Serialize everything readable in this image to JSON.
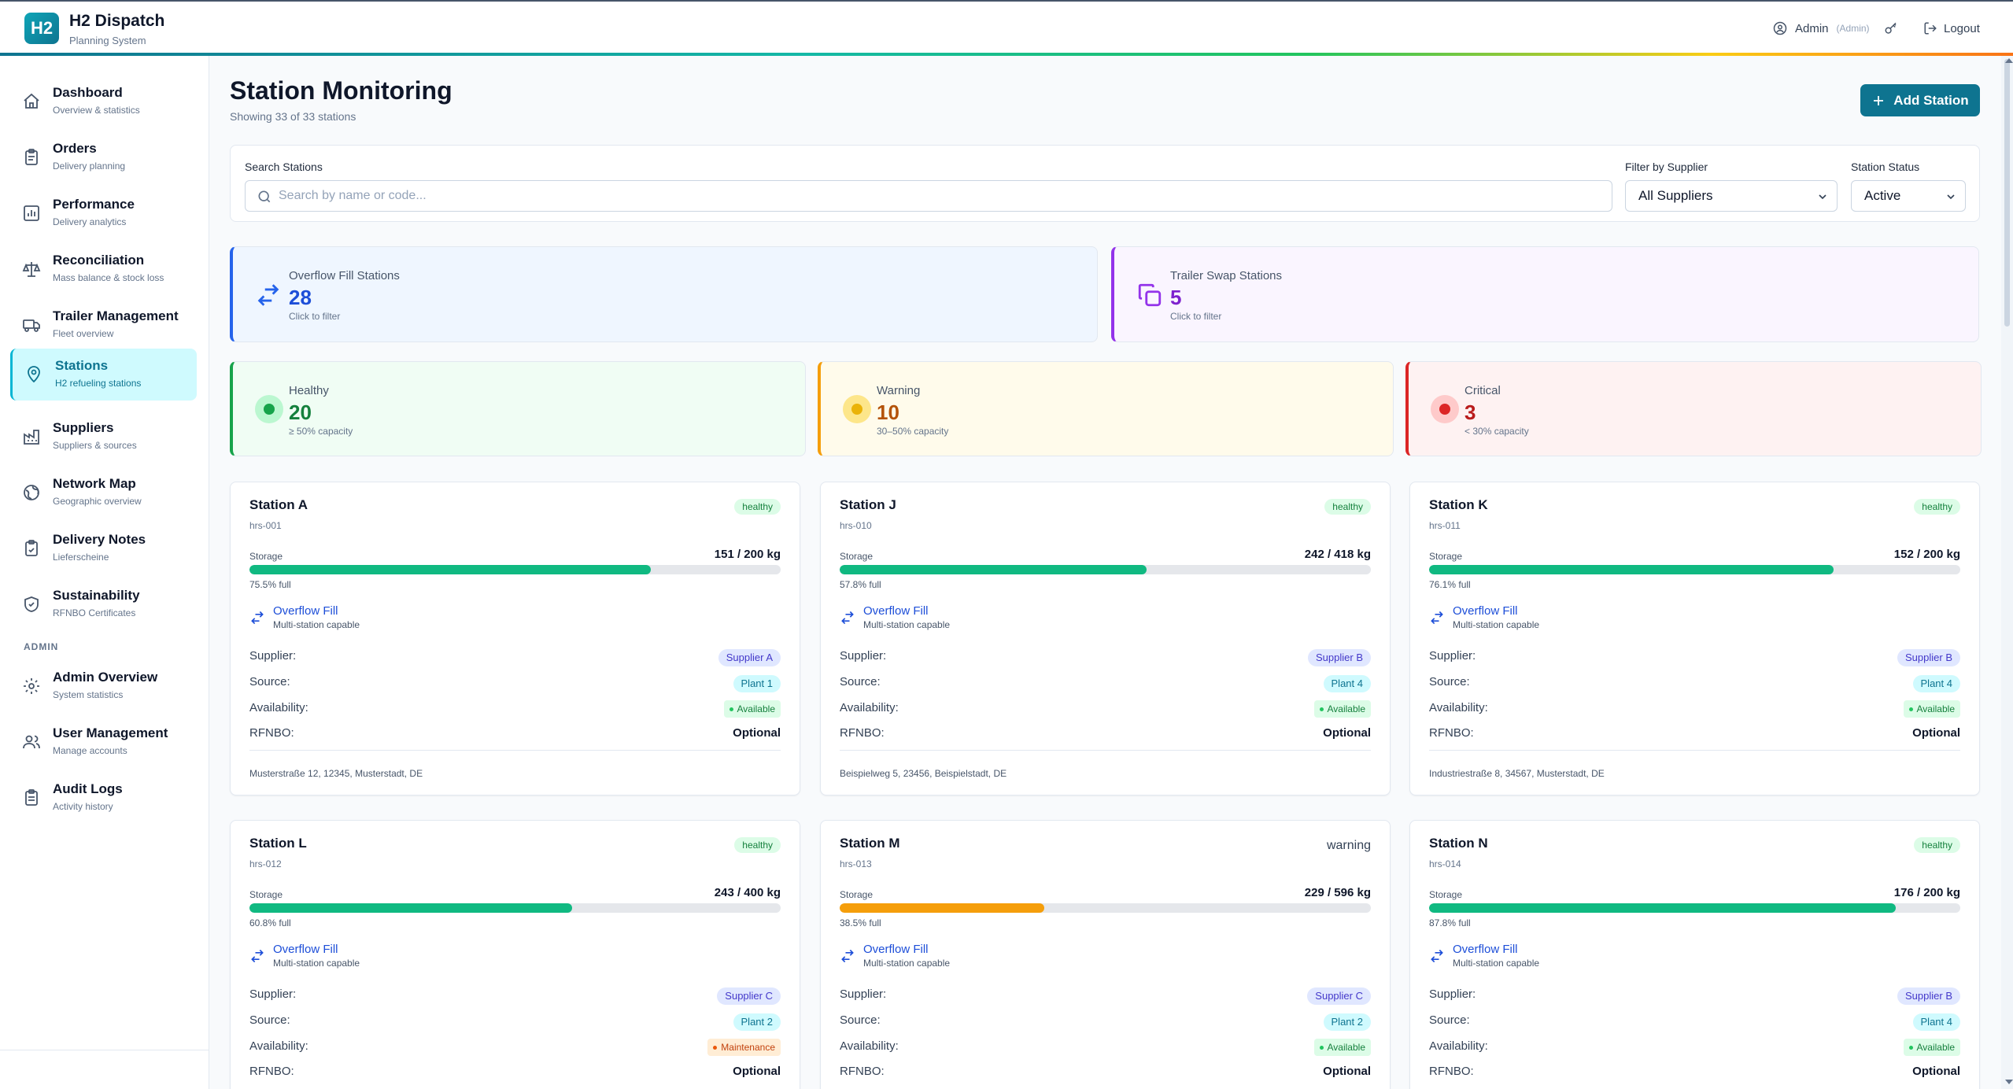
{
  "app": {
    "logo_text": "H2",
    "title": "H2 Dispatch",
    "subtitle": "Planning System"
  },
  "header": {
    "user": "Admin",
    "role": "(Admin)",
    "logout": "Logout"
  },
  "sidebar": {
    "items": [
      {
        "label": "Dashboard",
        "desc": "Overview & statistics",
        "icon": "home-icon"
      },
      {
        "label": "Orders",
        "desc": "Delivery planning",
        "icon": "clipboard-icon"
      },
      {
        "label": "Performance",
        "desc": "Delivery analytics",
        "icon": "chart-icon"
      },
      {
        "label": "Reconciliation",
        "desc": "Mass balance & stock loss",
        "icon": "scale-icon"
      },
      {
        "label": "Trailer Management",
        "desc": "Fleet overview",
        "icon": "truck-icon"
      },
      {
        "label": "Stations",
        "desc": "H2 refueling stations",
        "icon": "map-pin-icon"
      },
      {
        "label": "Suppliers",
        "desc": "Suppliers & sources",
        "icon": "factory-icon"
      },
      {
        "label": "Network Map",
        "desc": "Geographic overview",
        "icon": "globe-icon"
      },
      {
        "label": "Delivery Notes",
        "desc": "Lieferscheine",
        "icon": "document-check-icon"
      },
      {
        "label": "Sustainability",
        "desc": "RFNBO Certificates",
        "icon": "shield-check-icon"
      }
    ],
    "admin_section": "ADMIN",
    "admin_items": [
      {
        "label": "Admin Overview",
        "desc": "System statistics",
        "icon": "gear-icon"
      },
      {
        "label": "User Management",
        "desc": "Manage accounts",
        "icon": "users-icon"
      },
      {
        "label": "Audit Logs",
        "desc": "Activity history",
        "icon": "log-icon"
      }
    ]
  },
  "main": {
    "title": "Station Monitoring",
    "subtitle": "Showing 33 of 33 stations",
    "add_button": "Add Station",
    "filters": {
      "search_label": "Search Stations",
      "search_placeholder": "Search by name or code...",
      "search_value": "",
      "supplier_label": "Filter by Supplier",
      "supplier_value": "All Suppliers",
      "status_label": "Station Status",
      "status_value": "Active"
    },
    "stats": {
      "overflow": {
        "label": "Overflow Fill Stations",
        "value": "28",
        "hint": "Click to filter"
      },
      "trailer": {
        "label": "Trailer Swap Stations",
        "value": "5",
        "hint": "Click to filter"
      },
      "healthy": {
        "label": "Healthy",
        "value": "20",
        "hint": "≥ 50% capacity"
      },
      "warning": {
        "label": "Warning",
        "value": "10",
        "hint": "30–50% capacity"
      },
      "critical": {
        "label": "Critical",
        "value": "3",
        "hint": "< 30% capacity"
      }
    },
    "card_labels": {
      "storage": "Storage",
      "overflow_title": "Overflow Fill",
      "overflow_sub": "Multi-station capable",
      "supplier": "Supplier:",
      "source": "Source:",
      "availability": "Availability:",
      "rfnbo": "RFNBO:"
    },
    "stations": [
      {
        "name": "Station A",
        "code": "hrs-001",
        "status": "healthy",
        "storage": "151 / 200 kg",
        "fill": 0.755,
        "pct": "75.5% full",
        "supplier": "Supplier A",
        "source": "Plant 1",
        "availability": "Available",
        "rfnbo": "Optional",
        "address": "Musterstraße 12, 12345, Musterstadt, DE"
      },
      {
        "name": "Station J",
        "code": "hrs-010",
        "status": "healthy",
        "storage": "242 / 418 kg",
        "fill": 0.578,
        "pct": "57.8% full",
        "supplier": "Supplier B",
        "source": "Plant 4",
        "availability": "Available",
        "rfnbo": "Optional",
        "address": "Beispielweg 5, 23456, Beispielstadt, DE"
      },
      {
        "name": "Station K",
        "code": "hrs-011",
        "status": "healthy",
        "storage": "152 / 200 kg",
        "fill": 0.761,
        "pct": "76.1% full",
        "supplier": "Supplier B",
        "source": "Plant 4",
        "availability": "Available",
        "rfnbo": "Optional",
        "address": "Industriestraße 8, 34567, Musterstadt, DE"
      },
      {
        "name": "Station L",
        "code": "hrs-012",
        "status": "healthy",
        "storage": "243 / 400 kg",
        "fill": 0.608,
        "pct": "60.8% full",
        "supplier": "Supplier C",
        "source": "Plant 2",
        "availability": "Maintenance",
        "rfnbo": "Optional",
        "address": ""
      },
      {
        "name": "Station M",
        "code": "hrs-013",
        "status": "warning",
        "storage": "229 / 596 kg",
        "fill": 0.385,
        "pct": "38.5% full",
        "supplier": "Supplier C",
        "source": "Plant 2",
        "availability": "Available",
        "rfnbo": "Optional",
        "address": ""
      },
      {
        "name": "Station N",
        "code": "hrs-014",
        "status": "healthy",
        "storage": "176 / 200 kg",
        "fill": 0.878,
        "pct": "87.8% full",
        "supplier": "Supplier B",
        "source": "Plant 4",
        "availability": "Available",
        "rfnbo": "Optional",
        "address": ""
      }
    ]
  },
  "colors": {
    "accent": "#0e7490",
    "healthy_bar": "#10b981",
    "warning_bar": "#f59e0b",
    "blue": "#2563eb",
    "purple": "#9333ea",
    "amber": "#d97706",
    "red": "#dc2626",
    "green": "#16a34a"
  }
}
